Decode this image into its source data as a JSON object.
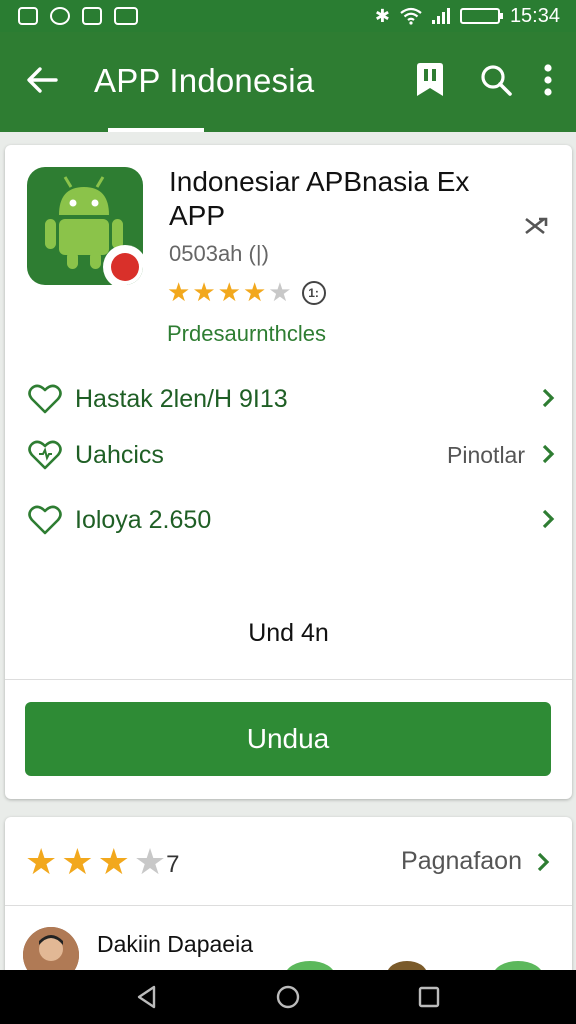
{
  "status_bar": {
    "time": "15:34",
    "notification_icons": [
      "screenshot-icon",
      "messenger-icon",
      "app-icon",
      "media-icon"
    ]
  },
  "app_bar": {
    "title": "APP Indonesia",
    "icons": [
      "back-arrow-icon",
      "bookmark-icon",
      "search-icon",
      "more-vert-icon"
    ],
    "colors": {
      "primary": "#2e7d32",
      "status": "#2a7d32"
    }
  },
  "app_card": {
    "name": "Indonesiar APBnasia Ex APP",
    "subtitle": "0503ah (|)",
    "rating_badge": "1:",
    "developer": "Prdesaurnthcles",
    "rows": [
      {
        "icon": "heart-outline-icon",
        "label": "Hastak 2len/H 9I13",
        "value": ""
      },
      {
        "icon": "heart-outline-icon",
        "label": "Uahcics",
        "value": "Pinotlar"
      },
      {
        "icon": "heart-outline-icon",
        "label": "Ioloya 2.650",
        "value": ""
      }
    ],
    "size_text": "Und 4n",
    "install_label": "Undua",
    "accent": "#2e8b35"
  },
  "ratings_card": {
    "stars_full": 3,
    "count": "7",
    "more_link": "Pagnafaon",
    "reviewer_name": "Dakiin Dapaeia"
  },
  "nav_bar": {
    "icons": [
      "back-triangle-icon",
      "home-circle-icon",
      "recents-square-icon"
    ]
  }
}
